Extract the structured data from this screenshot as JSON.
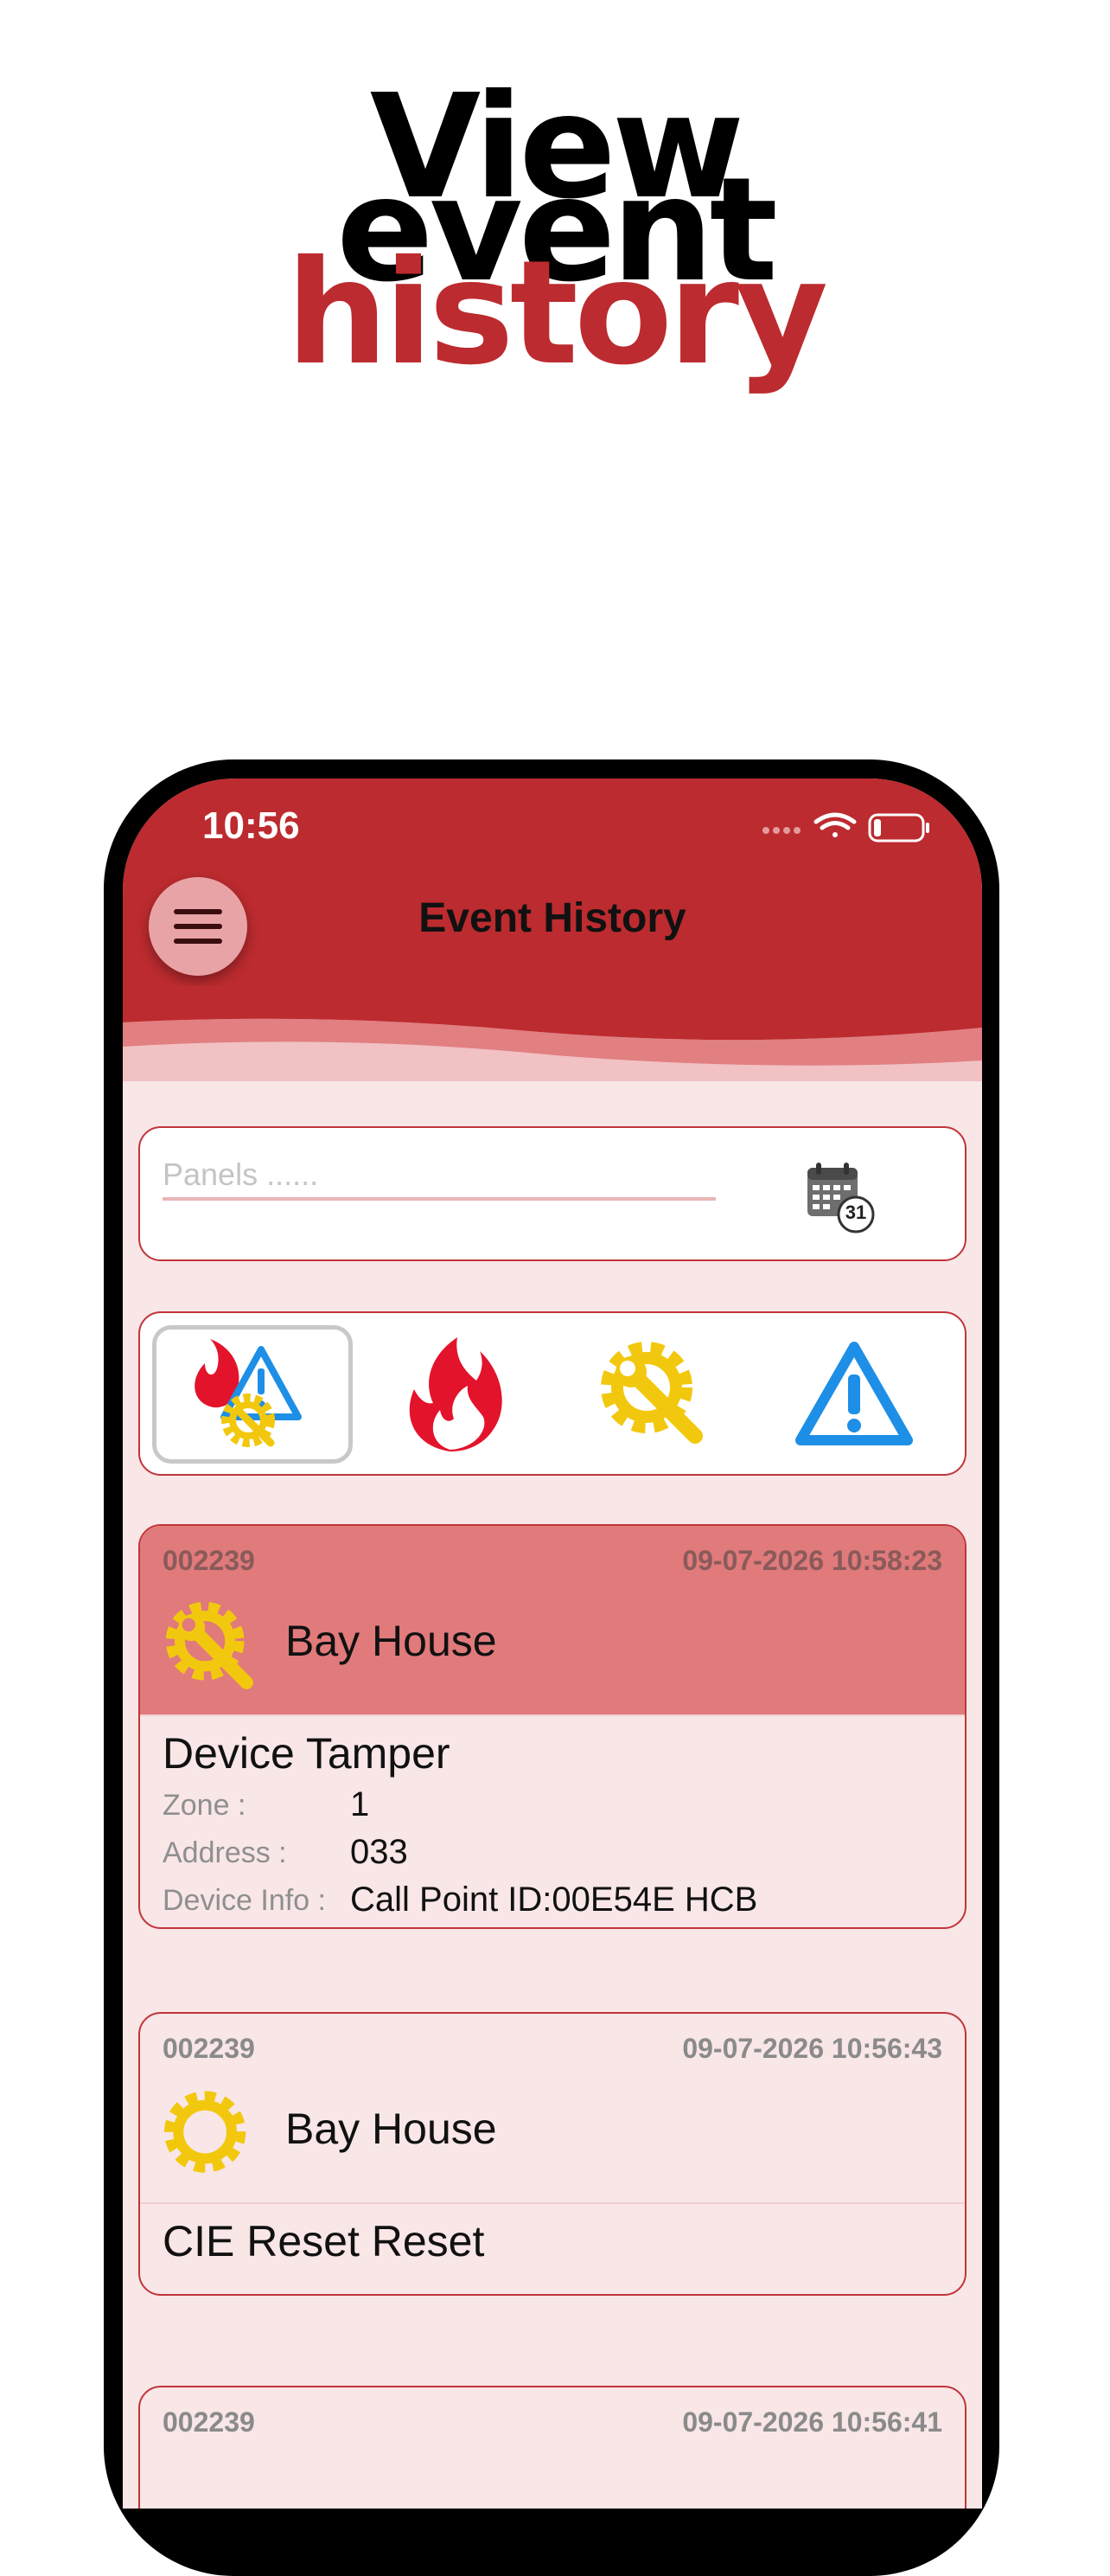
{
  "headline": {
    "line1": "View",
    "line2": "event",
    "line3": "history"
  },
  "status_bar": {
    "time": "10:56"
  },
  "header": {
    "title": "Event History"
  },
  "panels": {
    "placeholder": "Panels ......",
    "calendar_day": "31"
  },
  "filters": [
    {
      "name": "all",
      "icon": "combined-fire-warning-gear-icon",
      "active": true
    },
    {
      "name": "fire",
      "icon": "fire-icon",
      "active": false
    },
    {
      "name": "fault",
      "icon": "gear-wrench-icon",
      "active": false
    },
    {
      "name": "warning",
      "icon": "warning-triangle-icon",
      "active": false
    }
  ],
  "events": [
    {
      "id": "002239",
      "timestamp": "09-07-2026 10:58:23",
      "site": "Bay House",
      "icon": "gear-wrench-icon",
      "event": "Device Tamper",
      "zone_label": "Zone :",
      "zone": "1",
      "address_label": "Address :",
      "address": "033",
      "device_info_label": "Device Info :",
      "device_info": "Call Point ID:00E54E HCB"
    },
    {
      "id": "002239",
      "timestamp": "09-07-2026 10:56:43",
      "site": "Bay House",
      "icon": "gear-icon",
      "event": "CIE Reset Reset"
    },
    {
      "id": "002239",
      "timestamp": "09-07-2026 10:56:41"
    }
  ],
  "colors": {
    "brand_red": "#bc2b2f",
    "highlight_row": "#e07a7b",
    "card_bg": "#f9e6e7",
    "fire": "#e3132b",
    "fault": "#f2c80f",
    "warning": "#1e8fe6"
  }
}
